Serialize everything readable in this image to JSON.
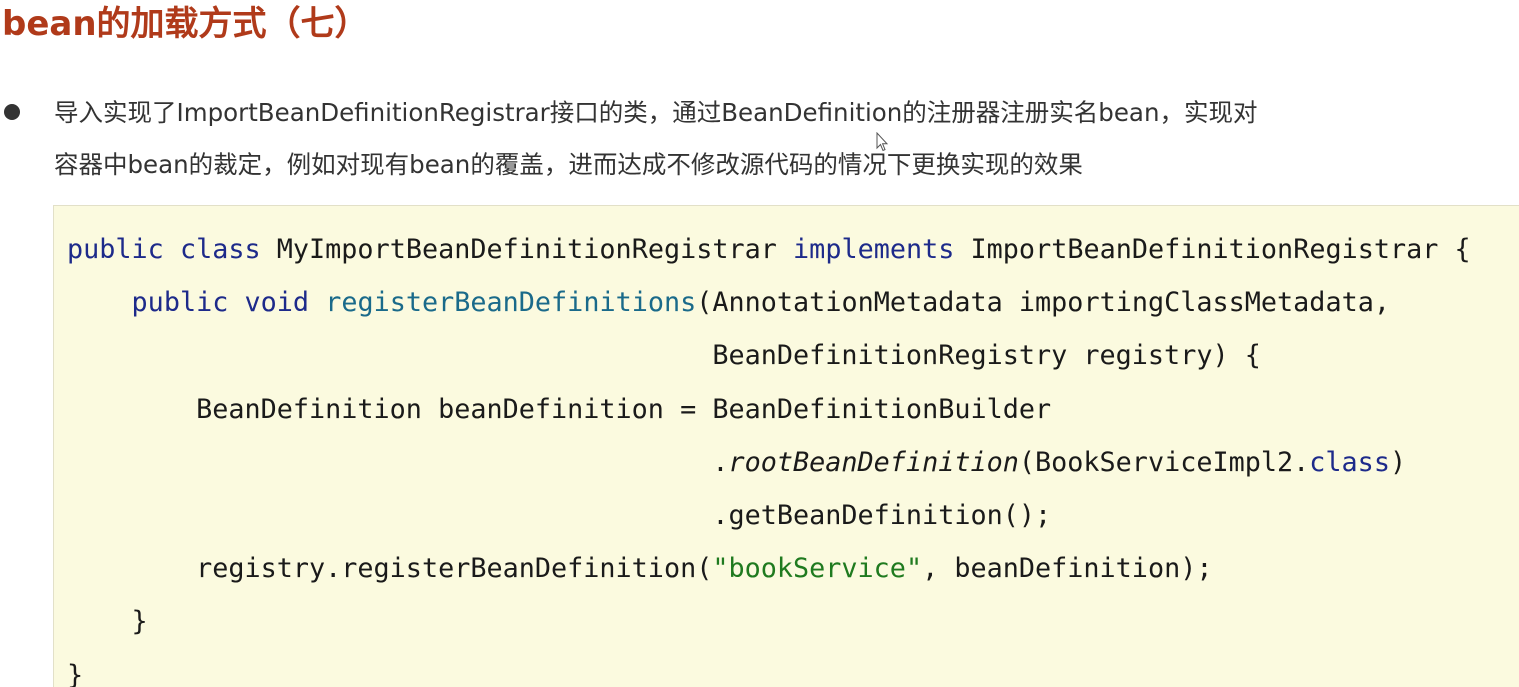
{
  "title": "bean的加载方式（七）",
  "bullet": {
    "line1": "导入实现了ImportBeanDefinitionRegistrar接口的类，通过BeanDefinition的注册器注册实名bean，实现对",
    "line2": "容器中bean的裁定，例如对现有bean的覆盖，进而达成不修改源代码的情况下更换实现的效果"
  },
  "code": {
    "l1": {
      "kw1": "public",
      "kw2": "class",
      "name": "MyImportBeanDefinitionRegistrar",
      "kw3": "implements",
      "iface": "ImportBeanDefinitionRegistrar",
      "brace": "{"
    },
    "l2": {
      "indent": "    ",
      "kw1": "public",
      "kw2": "void",
      "method": "registerBeanDefinitions",
      "params": "(AnnotationMetadata importingClassMetadata,"
    },
    "l3": {
      "indent": "                                        ",
      "text": "BeanDefinitionRegistry registry) {"
    },
    "l4": {
      "indent": "        ",
      "text": "BeanDefinition beanDefinition = BeanDefinitionBuilder"
    },
    "l5": {
      "indent": "                                        ",
      "dot": ".",
      "method": "rootBeanDefinition",
      "args": "(BookServiceImpl2.",
      "kw": "class",
      "close": ")"
    },
    "l6": {
      "indent": "                                        ",
      "text": ".getBeanDefinition();"
    },
    "l7": {
      "indent": "        ",
      "pre": "registry.registerBeanDefinition(",
      "str": "\"bookService\"",
      "post": ", beanDefinition);"
    },
    "l8": {
      "indent": "    ",
      "text": "}"
    },
    "l9": {
      "text": "}"
    }
  },
  "colors": {
    "title": "#b03a1a",
    "code_background": "#fbfadf",
    "keyword": "#1d2a8a",
    "method": "#1a6a8a",
    "string": "#1f7a1f"
  },
  "icons": {
    "cursor": "mouse-pointer-icon"
  }
}
